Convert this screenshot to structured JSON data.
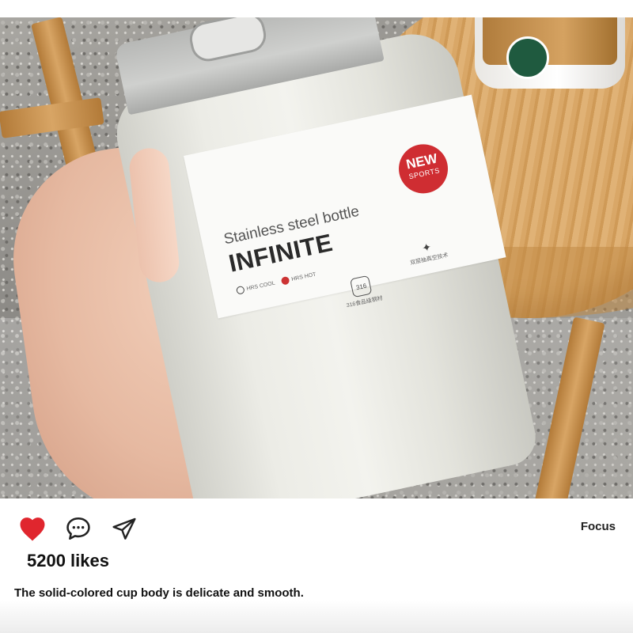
{
  "post": {
    "image": {
      "alt": "",
      "label": {
        "subtitle": "Stainless steel bottle",
        "brand": "INFINITE",
        "badge_line1": "NEW",
        "badge_line2": "SPORTS",
        "feature_cold": "HRS COOL",
        "feature_hot": "HRS HOT",
        "feature_material_badge": "316",
        "feature_material_text": "316食品级钢材",
        "feature_gear_text": "双层抽真空技术"
      }
    },
    "actions": {
      "like_icon": "heart-icon",
      "comment_icon": "comment-bubble-icon",
      "share_icon": "send-paper-plane-icon"
    },
    "focus_label": "Focus",
    "likes_text": "5200 likes",
    "caption": "The solid-colored cup body is delicate and smooth."
  },
  "colors": {
    "heart": "#e0262e",
    "badge": "#cf2d32",
    "text": "#111111"
  }
}
